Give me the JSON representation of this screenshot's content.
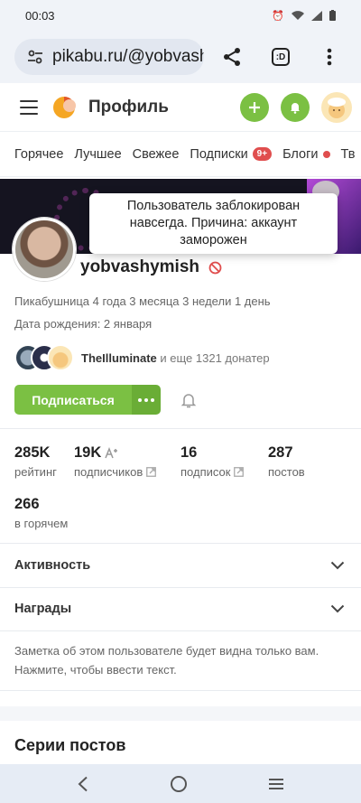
{
  "status_bar": {
    "time": "00:03"
  },
  "browser": {
    "url": "pikabu.ru/@yobvashymish",
    "tab_count": ":D"
  },
  "header": {
    "title": "Профиль"
  },
  "nav_tabs": [
    {
      "label": "Горячее"
    },
    {
      "label": "Лучшее"
    },
    {
      "label": "Свежее"
    },
    {
      "label": "Подписки",
      "badge": "9+"
    },
    {
      "label": "Блоги"
    },
    {
      "label": "Тв"
    }
  ],
  "tooltip": {
    "text": "Пользователь заблокирован навсегда. Причина: аккаунт заморожен"
  },
  "profile": {
    "username": "yobvashymish",
    "membership": "Пикабушница 4 года 3 месяца 3 недели 1 день",
    "birthday": "Дата рождения: 2 января",
    "donors": {
      "name": "TheIlluminate",
      "rest": " и еще 1321 донатер"
    },
    "subscribe_label": "Подписаться"
  },
  "stats": [
    {
      "value": "285K",
      "label": "рейтинг"
    },
    {
      "value": "19K",
      "label": "подписчиков"
    },
    {
      "value": "16",
      "label": "подписок"
    },
    {
      "value": "287",
      "label": "постов"
    },
    {
      "value": "266",
      "label": "в горячем"
    }
  ],
  "sections": {
    "activity": "Активность",
    "awards": "Награды"
  },
  "note": "Заметка об этом пользователе будет видна только вам. Нажмите, чтобы ввести текст.",
  "series_title": "Серии постов",
  "colors": {
    "accent": "#7bc043",
    "badge": "#e04e4e"
  }
}
